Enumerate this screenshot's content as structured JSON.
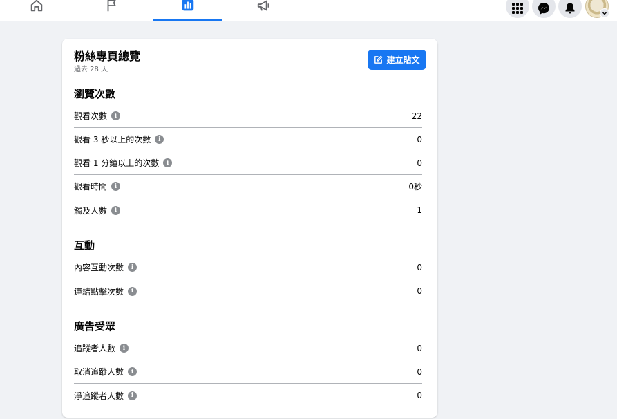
{
  "topbar": {
    "tabs": [
      {
        "name": "home",
        "icon": "home-icon",
        "active": false
      },
      {
        "name": "pages",
        "icon": "flag-icon",
        "active": false
      },
      {
        "name": "insights",
        "icon": "bar-chart-icon",
        "active": true
      },
      {
        "name": "ads",
        "icon": "megaphone-icon",
        "active": false
      }
    ],
    "accent": "#1877f2"
  },
  "card": {
    "title": "粉絲專頁總覽",
    "subtitle": "過去 28 天",
    "create_button": "建立貼文",
    "sections": [
      {
        "title": "瀏覽次數",
        "rows": [
          {
            "label": "觀看次數",
            "value": "22"
          },
          {
            "label": "觀看 3 秒以上的次數",
            "value": "0"
          },
          {
            "label": "觀看 1 分鐘以上的次數",
            "value": "0"
          },
          {
            "label": "觀看時間",
            "value": "0秒"
          },
          {
            "label": "觸及人數",
            "value": "1"
          }
        ]
      },
      {
        "title": "互動",
        "rows": [
          {
            "label": "內容互動次數",
            "value": "0"
          },
          {
            "label": "連結點擊次數",
            "value": "0"
          }
        ]
      },
      {
        "title": "廣告受眾",
        "rows": [
          {
            "label": "追蹤者人數",
            "value": "0"
          },
          {
            "label": "取消追蹤人數",
            "value": "0"
          },
          {
            "label": "淨追蹤者人數",
            "value": "0"
          }
        ]
      }
    ]
  }
}
